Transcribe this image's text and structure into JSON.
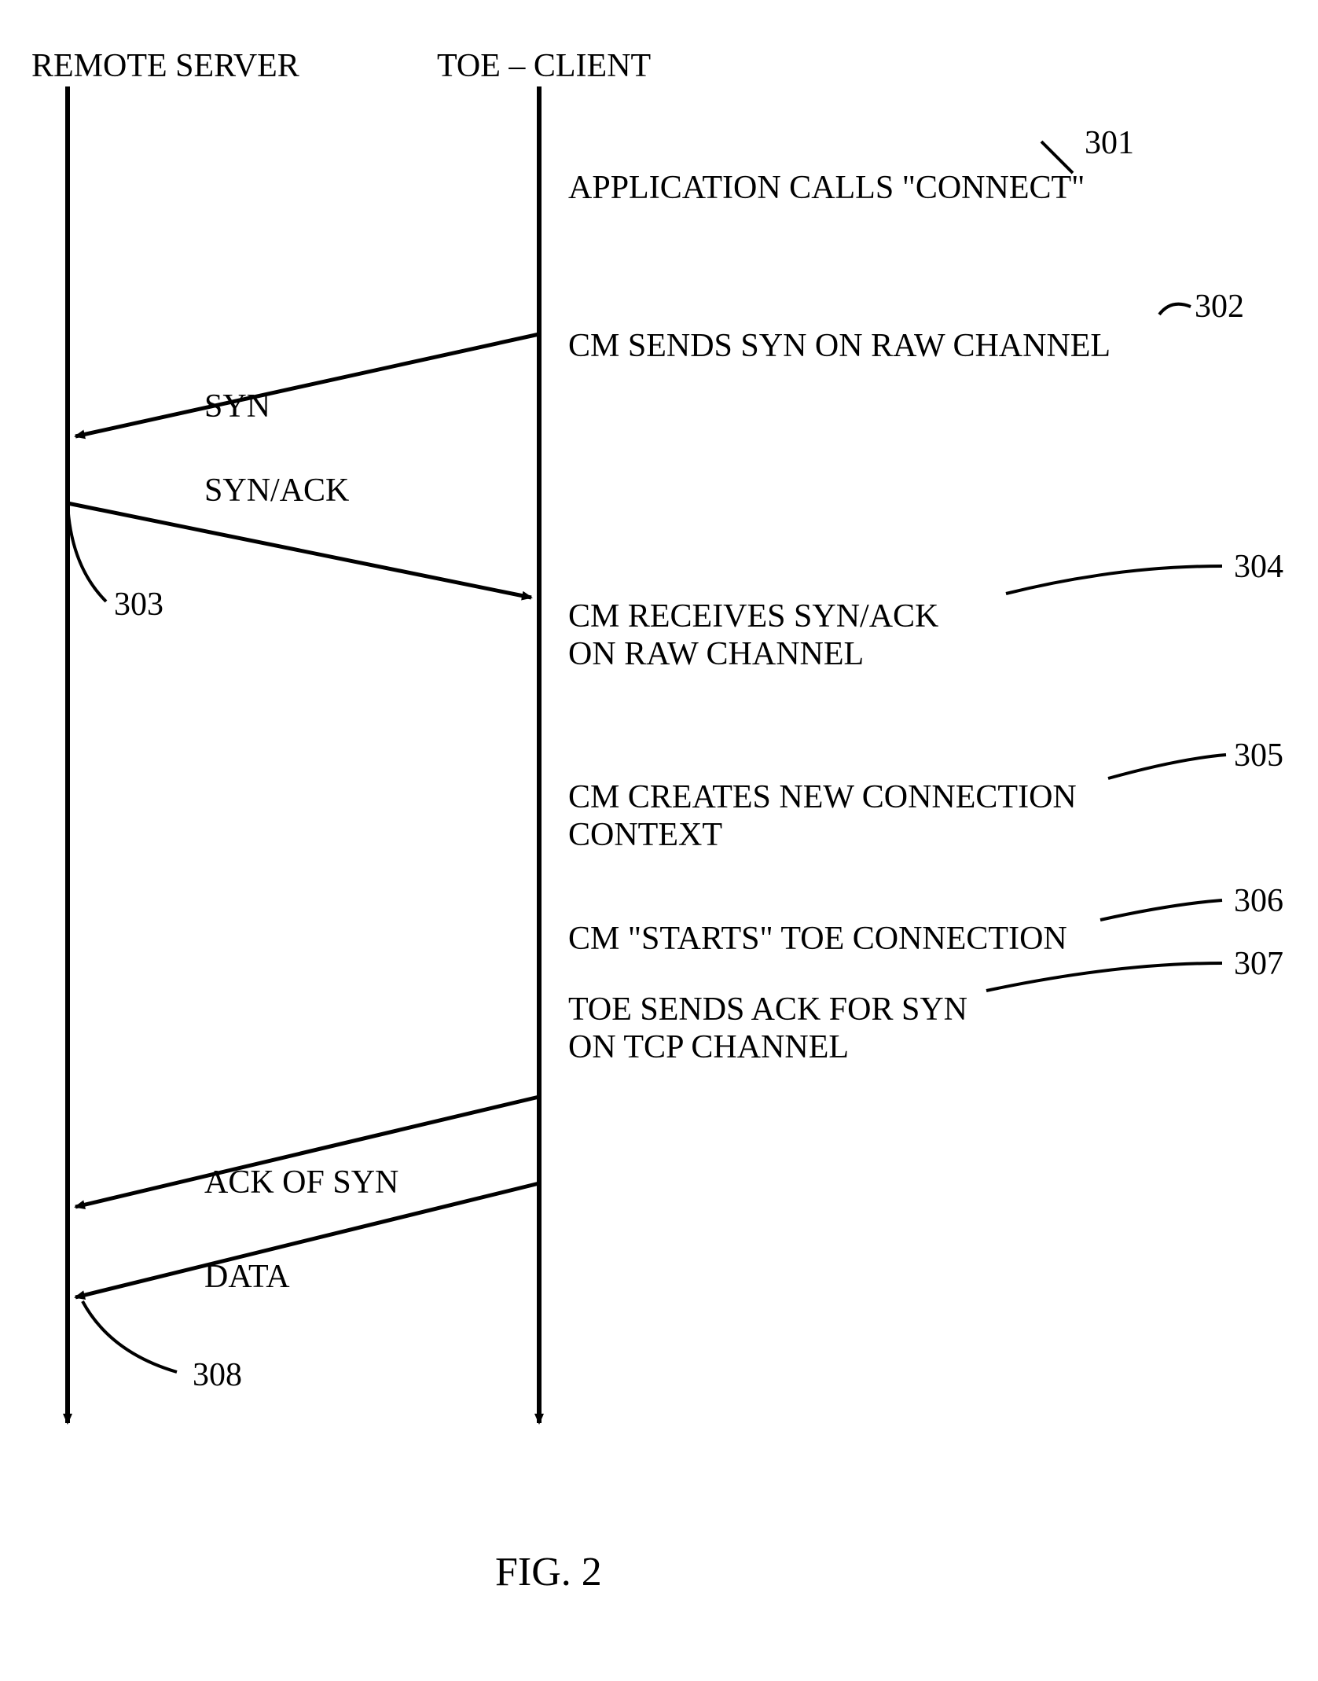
{
  "headers": {
    "left": "REMOTE SERVER",
    "right": "TOE – CLIENT"
  },
  "messages": {
    "syn": "SYN",
    "synack": "SYN/ACK",
    "ackofsyn": "ACK OF SYN",
    "data": "DATA"
  },
  "steps": {
    "s301": "APPLICATION CALLS \"CONNECT\"",
    "s302": "CM SENDS SYN ON RAW CHANNEL",
    "s304": "CM RECEIVES SYN/ACK\nON RAW CHANNEL",
    "s305": "CM CREATES NEW CONNECTION\nCONTEXT",
    "s306": "CM \"STARTS\" TOE CONNECTION",
    "s307": "TOE SENDS ACK FOR SYN\nON TCP CHANNEL"
  },
  "refs": {
    "r301": "301",
    "r302": "302",
    "r303": "303",
    "r304": "304",
    "r305": "305",
    "r306": "306",
    "r307": "307",
    "r308": "308"
  },
  "figure_caption": "FIG. 2"
}
